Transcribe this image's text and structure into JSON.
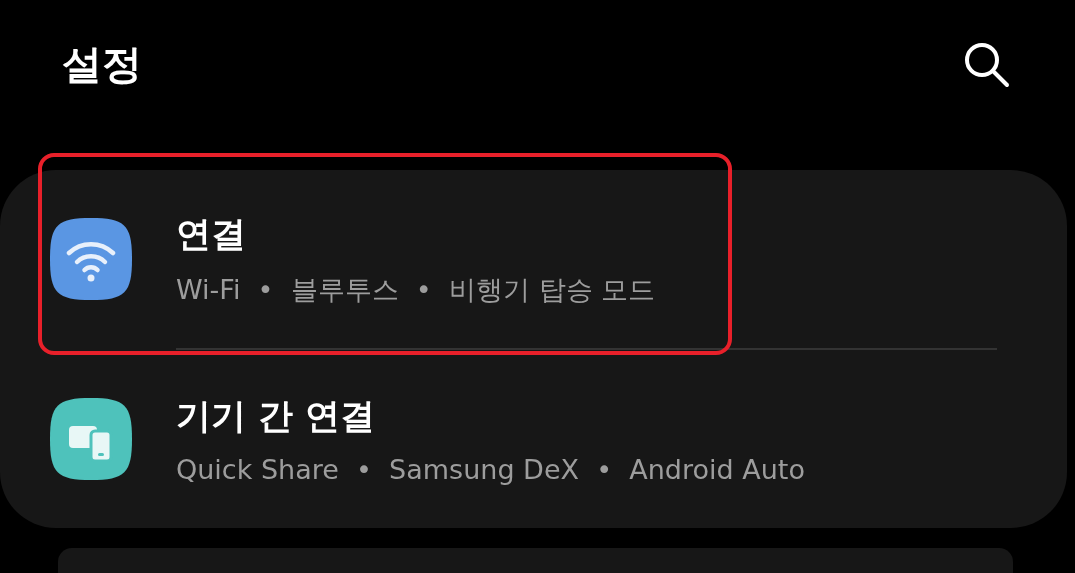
{
  "header": {
    "title": "설정"
  },
  "items": [
    {
      "kind": "wifi",
      "color": "#5a96e3",
      "title": "연결",
      "subtitle": "Wi-Fi  •  블루투스  •  비행기 탑승 모드",
      "highlighted": true
    },
    {
      "kind": "devices",
      "color": "#4ec2bb",
      "title": "기기 간 연결",
      "subtitle": "Quick Share  •  Samsung DeX  •  Android Auto",
      "highlighted": false
    }
  ]
}
